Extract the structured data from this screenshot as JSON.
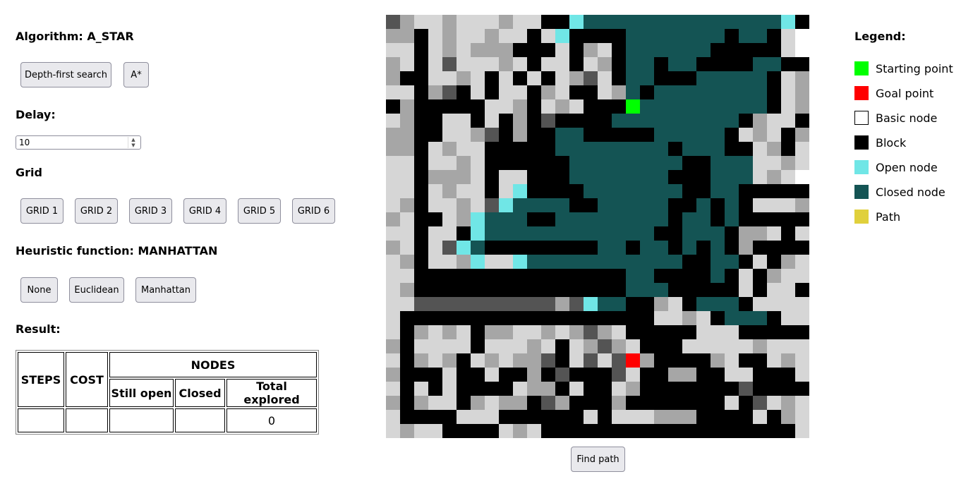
{
  "algorithm": {
    "label": "Algorithm: A_STAR",
    "buttons": [
      "Depth-first search",
      "A*"
    ]
  },
  "delay": {
    "label": "Delay:",
    "value": "10"
  },
  "grid_section": {
    "label": "Grid",
    "buttons": [
      "GRID 1",
      "GRID 2",
      "GRID 3",
      "GRID 4",
      "GRID 5",
      "GRID 6"
    ]
  },
  "heuristic": {
    "label": "Heuristic function: MANHATTAN",
    "buttons": [
      "None",
      "Euclidean",
      "Manhattan"
    ]
  },
  "result": {
    "label": "Result:",
    "headers": {
      "steps": "STEPS",
      "cost": "COST",
      "nodes": "NODES",
      "still_open": "Still open",
      "closed": "Closed",
      "total_explored": "Total explored"
    },
    "values": {
      "steps": "",
      "cost": "",
      "still_open": "",
      "closed": "",
      "total_explored": "0"
    }
  },
  "find_button": "Find path",
  "legend": {
    "title": "Legend:",
    "items": [
      {
        "label": "Starting point",
        "color": "#00ff00"
      },
      {
        "label": "Goal point",
        "color": "#ff0000"
      },
      {
        "label": "Basic node",
        "color": "#ffffff"
      },
      {
        "label": "Block",
        "color": "#000000"
      },
      {
        "label": "Open node",
        "color": "#70e6e6"
      },
      {
        "label": "Closed node",
        "color": "#145454"
      },
      {
        "label": "Path",
        "color": "#e0d03c"
      }
    ]
  },
  "grid_map": {
    "rows": [
      "DGLLGLXLGLLBBOCCCCCCCCCCCCCCOBB",
      "GGBLGLLGLLBLOBBBBCCCCCCCBCCBLWL",
      "LLBLGLGGGBBBLBGLBCCCCCCBBBBBLWL",
      "GLBLDLLLGLBLLBLGBCCBCCBBBBCCBBL",
      "GBBLLGLBLBLBLGDLBCCBBBCCCCCBLGL",
      "LLBGDBLBLLBGLBBLGCBCCCCCCCCBLGL",
      "BGBBBBBLLGBLGLBBBSCCCCCCCCCBLGL",
      "LGBBLLBLBGBDBBBBCCCCCCCCCBGLLBG",
      "GGBBLLGDBGBBCCBBBBBCCCCCBLGLBGD",
      "GGBLGLLBBBBBCCCCCCCCBCCCBBLGBLD",
      "LLBLLGLBBBBBBCCCCCCCCBBCCCLLGLG",
      "LLBGGGLBLLBBBCCCCCCCBBBCCCLGLWG",
      "LLBLGLLBLOBBBBCCCCCCCBBCCBBBBBG",
      "LGBLLGLDOCCCCBBCCCCCBBCBCBLLLGL",
      "GLBBLGOCCCBBCCCCCCCCBCCBCBBBBBL",
      "LLBLLBOCCCCCCCCCCCCBBCCCBGGLBLG",
      "GLBLDOCBBBBBBBBCCBCCBCBCBGBBBBL",
      "LGBLLGOLLOCCCCCCCCCCCBBCCBLBGLL",
      "LLBBBBBBBBBBBBBBBCCBBBBCBLBGLLB",
      "LGBBBBBBBBBBBBBBBCCCBBBBBLBLLBG",
      "LLDDDDDDDDDDGDOCCBBGLBCCCBLLLLB",
      "LBBBBBBBBBBBBBBBBBBLLGLBCCCBLLLB",
      "LBGLGLBGGLLGLGDGLBBBBBLLLBBBBBB",
      "GBLLLLBLLLGLBLGDGLBBBLLLLLGLLLL",
      "LBGLGBLGLGGDBLDLDRGBBBBGLBBLGLB",
      "GBBBLBBLBBGBDBBBDLBBGGBBLLBBBLG",
      "LBLBLBBBBLGGBLBBLGBBBBBBBDBBBBG",
      "GBGLLBGLGGBDGBBBGBBBBBBBLBDLGLB",
      "LBBBBLLLBBBBBBLBLLLGGGBBBBLBGLB",
      "LGLLBBBBLGLBBBBBBBBBBBBBBBBBBLG",
      "GGLGGGLGLGGLGLDLDGLLGGGGGLLGLGL"
    ],
    "palette": {
      "B": "#000000",
      "C": "#145454",
      "O": "#70e6e6",
      "S": "#00ff00",
      "R": "#ff0000",
      "W": "#ffffff",
      "L": "#d6d6d6",
      "G": "#a6a6a6",
      "D": "#545454"
    }
  }
}
